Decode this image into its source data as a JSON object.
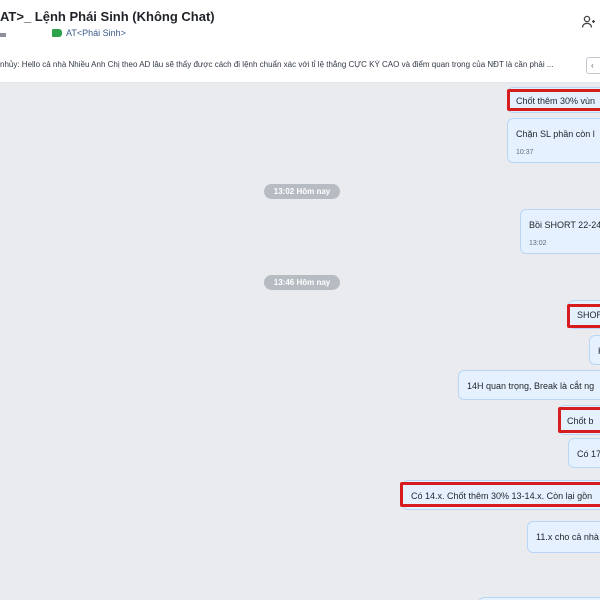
{
  "header": {
    "title": "AT>_ Lệnh Phái Sinh (Không Chat)",
    "tag": "AT<Phái Sinh>",
    "right_icon": "members-icon"
  },
  "pinned": {
    "text": "nhủy: Hello cả nhà Nhiều Anh Chị theo AD lâu sẽ thấy được cách đi lệnh chuẩn xác với tỉ lệ thắng CỰC KỲ CAO và điểm quan trọng của NĐT là cần phải ...",
    "button_label": "‹"
  },
  "colors": {
    "bubble_bg": "#e5f1ff",
    "bubble_border": "#b9d6f5",
    "highlight": "#d71c20",
    "chat_bg": "#e9ebee",
    "separator_bg": "#b7bcc3",
    "tag_color": "#2fa34b"
  },
  "separators": {
    "s1": "13:02 Hôm nay",
    "s2": "13:46 Hôm nay"
  },
  "messages": {
    "m1": {
      "text": "Chốt thêm 30% vùn",
      "highlighted": true
    },
    "m2": {
      "text": "Chặn SL phần còn l",
      "time": "10:37"
    },
    "m3": {
      "text": "Bồi SHORT 22-24",
      "time": "13:02"
    },
    "m4": {
      "text": "SHOR",
      "highlighted": true
    },
    "m5": {
      "text": "K"
    },
    "m6": {
      "text": "14H quan trọng, Break là cắt ng"
    },
    "m7": {
      "text": "Chốt b",
      "highlighted": true
    },
    "m8": {
      "text": "Có 17"
    },
    "m9": {
      "text": "Có 14.x. Chốt thêm 30% 13-14.x. Còn lại gồn",
      "highlighted": true
    },
    "m10": {
      "text": "11.x cho cả nhà"
    }
  }
}
